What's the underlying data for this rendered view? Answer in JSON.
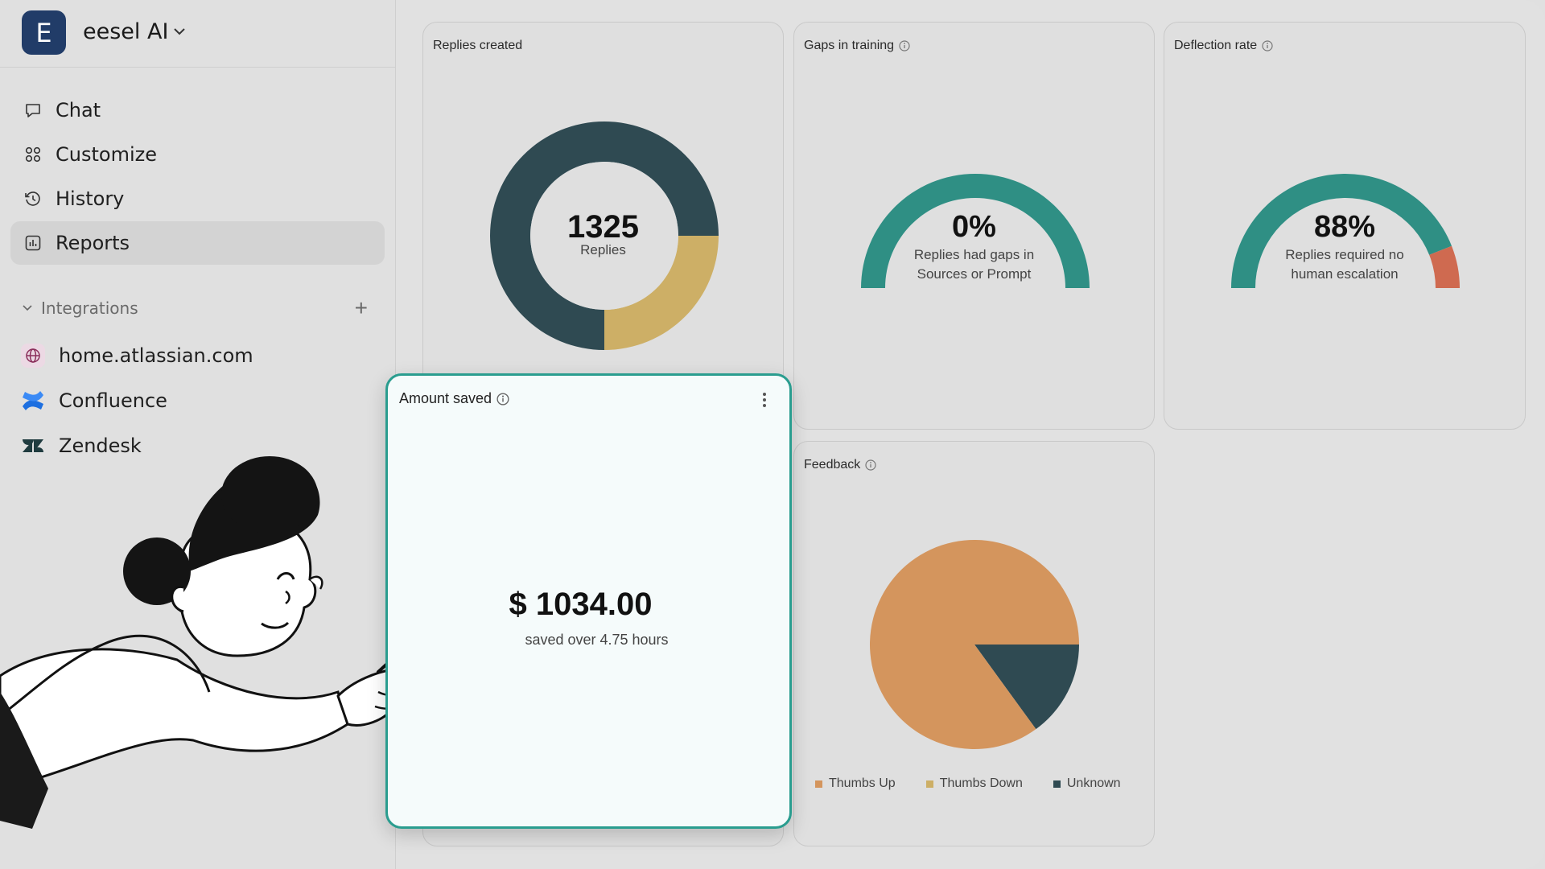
{
  "workspace": {
    "initial": "E",
    "name": "eesel AI"
  },
  "nav": [
    {
      "label": "Chat",
      "icon": "chat-bubble-icon"
    },
    {
      "label": "Customize",
      "icon": "grid-icon"
    },
    {
      "label": "History",
      "icon": "history-icon"
    },
    {
      "label": "Reports",
      "icon": "reports-icon",
      "active": true
    }
  ],
  "integrations": {
    "heading": "Integrations",
    "add_label": "+",
    "items": [
      {
        "label": "home.atlassian.com",
        "icon": "globe-icon"
      },
      {
        "label": "Confluence",
        "icon": "confluence-icon"
      },
      {
        "label": "Zendesk",
        "icon": "zendesk-icon"
      }
    ]
  },
  "cards": {
    "replies": {
      "title": "Replies created",
      "value": "1325",
      "unit": "Replies"
    },
    "gaps": {
      "title": "Gaps in training",
      "value": "0%",
      "caption_1": "Replies had gaps in",
      "caption_2": "Sources or Prompt"
    },
    "deflection": {
      "title": "Deflection rate",
      "value": "88%",
      "caption_1": "Replies required no",
      "caption_2": "human escalation"
    },
    "amount": {
      "title": "Amount saved",
      "value": "$ 1034.00",
      "caption": "saved over 4.75 hours"
    },
    "feedback": {
      "title": "Feedback"
    }
  },
  "colors": {
    "teal": "#2f8f84",
    "dark": "#2f4a52",
    "gold": "#cdaf66",
    "orange": "#d4955d",
    "red": "#cf6a50",
    "highlight_border": "#2a9d8f"
  },
  "chart_data": [
    {
      "type": "pie",
      "title": "Replies created",
      "donut": true,
      "center_label": "1325",
      "series": [
        {
          "values": [
            75,
            25
          ]
        }
      ],
      "colors": [
        "#2f4a52",
        "#cdaf66"
      ]
    },
    {
      "type": "gauge",
      "title": "Gaps in training",
      "value_percent": 0,
      "colors": [
        "#2f8f84"
      ]
    },
    {
      "type": "gauge",
      "title": "Deflection rate",
      "value_percent": 88,
      "colors": [
        "#2f8f84",
        "#cf6a50"
      ]
    },
    {
      "type": "pie",
      "title": "Feedback",
      "categories": [
        "Thumbs Up",
        "Thumbs Down",
        "Unknown"
      ],
      "values": [
        85,
        0,
        15
      ],
      "colors": [
        "#d4955d",
        "#cdaf66",
        "#2f4a52"
      ],
      "legend": "bottom"
    }
  ]
}
